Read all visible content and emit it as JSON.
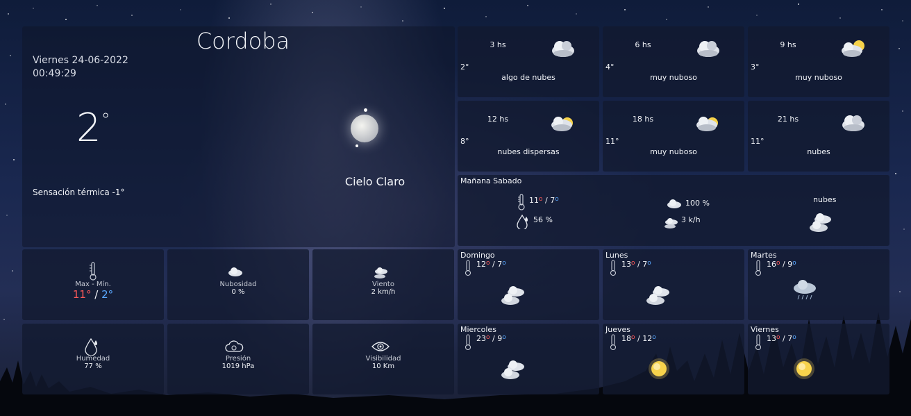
{
  "current": {
    "city": "Cordoba",
    "date": "Viernes 24-06-2022",
    "time": "00:49:29",
    "temp": "2",
    "deg_symbol": "°",
    "feels_like": "Sensación térmica -1°",
    "condition": "Cielo Claro"
  },
  "hourly": [
    {
      "time": "3 hs",
      "temp": "2°",
      "desc": "algo de nubes"
    },
    {
      "time": "6 hs",
      "temp": "4°",
      "desc": "muy nuboso"
    },
    {
      "time": "9 hs",
      "temp": "3°",
      "desc": "muy nuboso"
    },
    {
      "time": "12 hs",
      "temp": "8°",
      "desc": "nubes dispersas"
    },
    {
      "time": "18 hs",
      "temp": "11°",
      "desc": "muy nuboso"
    },
    {
      "time": "21 hs",
      "temp": "11°",
      "desc": "nubes"
    }
  ],
  "tomorrow": {
    "title": "Mañana Sabado",
    "max": "11",
    "min": "7",
    "humidity": "56 %",
    "cloudiness": "100 %",
    "wind": "3 k/h",
    "desc": "nubes"
  },
  "stats": {
    "maxmin_label": "Max - Mín.",
    "max": "11°",
    "sep": " / ",
    "min": "2°",
    "clouds_label": "Nubosidad",
    "clouds_value": "0 %",
    "wind_label": "Viento",
    "wind_value": "2 km/h",
    "humidity_label": "Humedad",
    "humidity_value": "77 %",
    "pressure_label": "Presión",
    "pressure_value": "1019 hPa",
    "visibility_label": "Visibilidad",
    "visibility_value": "10 Km"
  },
  "days": [
    {
      "name": "Domingo",
      "max": "12",
      "min": "7",
      "icon": "clouds-icon"
    },
    {
      "name": "Lunes",
      "max": "13",
      "min": "7",
      "icon": "clouds-icon"
    },
    {
      "name": "Martes",
      "max": "16",
      "min": "9",
      "icon": "rain-cloud-icon"
    },
    {
      "name": "Miercoles",
      "max": "23",
      "min": "9",
      "icon": "clouds-icon"
    },
    {
      "name": "Jueves",
      "max": "18",
      "min": "12",
      "icon": "sun-icon"
    },
    {
      "name": "Viernes",
      "max": "13",
      "min": "7",
      "icon": "sun-icon"
    }
  ],
  "colors": {
    "max": "#ff5a5a",
    "min": "#5aa8ff"
  }
}
